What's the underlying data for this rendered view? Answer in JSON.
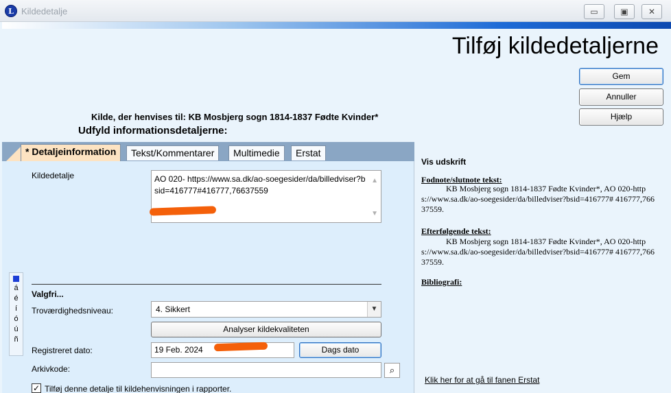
{
  "window": {
    "title": "Kildedetalje",
    "app_icon": "L",
    "controls": [
      "▭",
      "▣",
      "✕"
    ]
  },
  "header": {
    "title": "Tilføj kildedetaljerne",
    "source_line": "Kilde, der henvises til: KB Mosbjerg sogn 1814-1837 Fødte Kvinder*",
    "fill_heading": "Udfyld informationsdetaljerne:"
  },
  "buttons": {
    "save": "Gem",
    "cancel": "Annuller",
    "help": "Hjælp"
  },
  "tabs": [
    {
      "label": "* Detaljeinformation",
      "active": true
    },
    {
      "label": "Tekst/Kommentarer",
      "active": false
    },
    {
      "label": "Multimedie",
      "active": false
    },
    {
      "label": "Erstat",
      "active": false
    }
  ],
  "form": {
    "detail_label": "Kildedetalje",
    "detail_value": "AO 020- https://www.sa.dk/ao-soegesider/da/billedviser?bsid=416777#416777,76637559",
    "optional_heading": "Valgfri...",
    "reliability_label": "Troværdighedsniveau:",
    "reliability_value": "4.  Sikkert",
    "analyze_button": "Analyser kildekvaliteten",
    "date_label": "Registreret dato:",
    "date_value": "19 Feb. 2024",
    "today_button": "Dags dato",
    "archive_label": "Arkivkode:",
    "archive_value": "",
    "include_checkbox_label": "Tilføj denne detalje til kildehenvisningen i rapporter.",
    "include_checked": true
  },
  "char_bar": {
    "chars": [
      "á",
      "é",
      "í",
      "ó",
      "ú",
      "ñ"
    ]
  },
  "preview": {
    "heading": "Vis udskrift",
    "footnote_label": "Fodnote/slutnote tekst:",
    "footnote_text": "KB Mosbjerg sogn 1814-1837 Fødte Kvinder*, AO 020-https://www.sa.dk/ao-soegesider/da/billedviser?bsid=416777# 416777,76637559.",
    "subsequent_label": "Efterfølgende tekst:",
    "subsequent_text": "KB Mosbjerg sogn 1814-1837 Fødte Kvinder*, AO 020-https://www.sa.dk/ao-soegesider/da/billedviser?bsid=416777# 416777,76637559.",
    "bibliography_label": "Bibliografi:",
    "replace_link": "Klik her for at gå til fanen Erstat"
  },
  "colors": {
    "redaction": "#f4600a",
    "active_tab": "#fde3c2",
    "panel": "#ddeefc",
    "banner_blue": "#0d49b0"
  }
}
